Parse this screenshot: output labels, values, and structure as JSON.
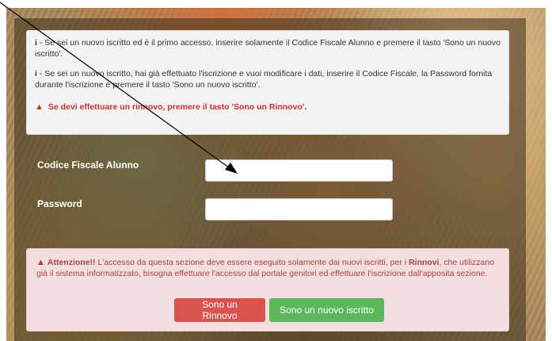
{
  "info": {
    "line1_icon": "info-icon",
    "line1_text": "- Se sei un nuovo iscritto ed è il primo accesso, inserire solamente il Codice Fiscale Alunno e premere il tasto 'Sono un nuovo iscritto'.",
    "line2_text": "- Se sei un nuovo iscritto, hai già effettuato l'iscrizione e vuoi modificare i dati, inserire il Codice Fiscale, la Password fornita durante l'iscrizione e premere il tasto 'Sono un nuovo iscritto'.",
    "warning_icon": "warning-icon",
    "warning_text": "Se devi effettuare un rinnovo, premere il tasto 'Sono un Rinnovo'."
  },
  "form": {
    "codice_fiscale_label": "Codice Fiscale Alunno",
    "codice_fiscale_value": "",
    "password_label": "Password",
    "password_value": ""
  },
  "alert": {
    "icon": "warning-icon",
    "title": "Attenzione!!",
    "text_before": " L'accesso da questa sezione deve essere eseguito solamente dai nuovi iscritti, per i ",
    "bold_word": "Rinnovi",
    "text_after": ", che utilizzano già il sistema informatizzato, bisogna effettuare l'accesso dal portale genitori ed effettuare l'iscrizione dall'apposita sezione."
  },
  "buttons": {
    "rinnovo_label": "Sono un Rinnovo",
    "nuovo_label": "Sono un nuovo iscritto"
  },
  "colors": {
    "danger": "#d9534f",
    "success": "#5cb85c",
    "alert_text": "#a94442",
    "alert_bg": "#f2dede"
  }
}
